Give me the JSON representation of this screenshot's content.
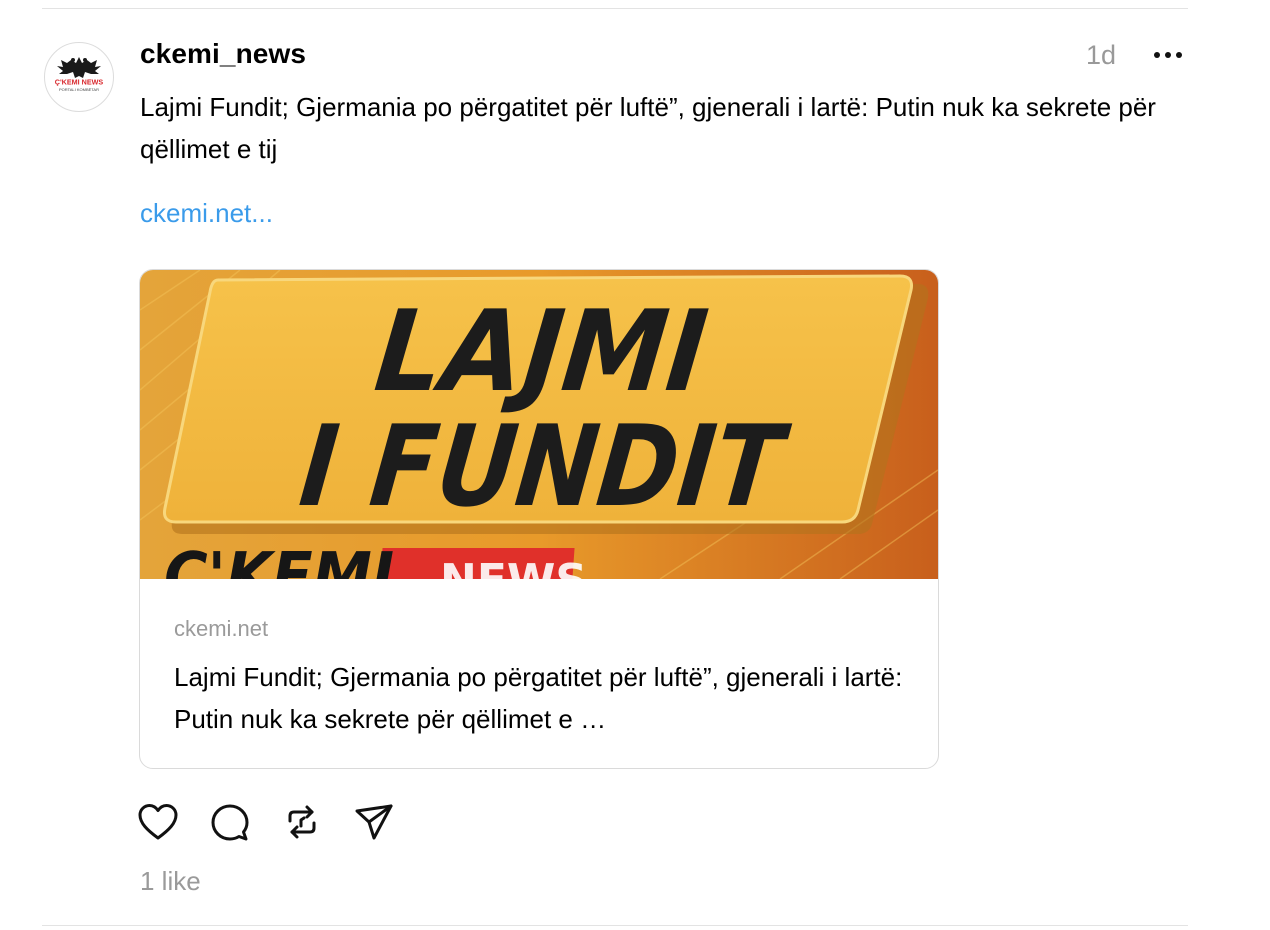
{
  "post": {
    "username": "ckemi_news",
    "timestamp": "1d",
    "text": "Lajmi Fundit; Gjermania po përgatitet për luftë”, gjenerali i lartë: Putin nuk ka sekrete për qëllimet e tij",
    "link_text": "ckemi.net...",
    "avatar": {
      "logo_text": "Ç'KEMI NEWS",
      "logo_subtext": "PORTALI KOMBËTAR"
    }
  },
  "card": {
    "image": {
      "headline_line1": "LAJMI",
      "headline_line2": "I FUNDIT",
      "brand_text": "Ç'KEMI",
      "brand_red_text": "NEWS"
    },
    "domain": "ckemi.net",
    "title": "Lajmi Fundit; Gjermania po përgatitet për luftë”, gjenerali i lartë: Putin nuk ka sekrete për qëllimet e …"
  },
  "actions": {
    "like_icon": "heart-icon",
    "comment_icon": "comment-icon",
    "repost_icon": "repost-icon",
    "share_icon": "send-icon"
  },
  "likes_text": "1 like",
  "colors": {
    "link": "#3a9bea",
    "muted": "#999999",
    "sign_yellow": "#f2b93b",
    "background_orange": "#e69a2e",
    "brand_red": "#e0302a"
  }
}
